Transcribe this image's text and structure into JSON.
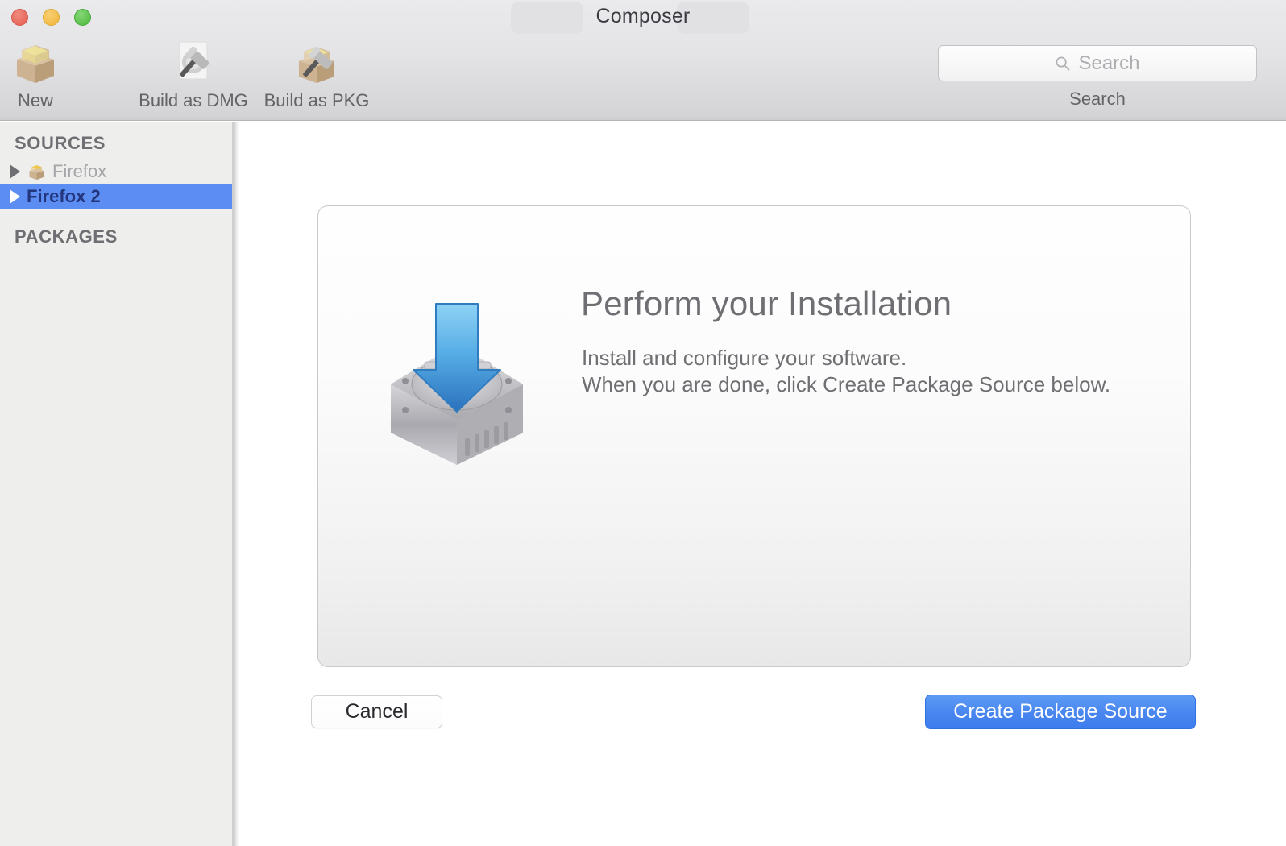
{
  "window": {
    "title": "Composer",
    "traffic_lights": [
      {
        "name": "close",
        "color": "#e8695c"
      },
      {
        "name": "minimize",
        "color": "#f3bc4a"
      },
      {
        "name": "zoom",
        "color": "#5cc14d"
      }
    ]
  },
  "toolbar": {
    "items": [
      {
        "id": "new",
        "label": "New",
        "icon": "package-box-icon"
      },
      {
        "id": "build-dmg",
        "label": "Build as DMG",
        "icon": "hammer-disk-icon"
      },
      {
        "id": "build-pkg",
        "label": "Build as PKG",
        "icon": "hammer-package-icon"
      }
    ],
    "search": {
      "placeholder": "Search",
      "value": "",
      "caption": "Search",
      "icon": "search-icon"
    }
  },
  "sidebar": {
    "sections": [
      {
        "id": "sources",
        "header": "SOURCES",
        "rows": [
          {
            "label": "Firefox",
            "selected": false,
            "has_icon": true,
            "disclosure": "collapsed"
          },
          {
            "label": "Firefox 2",
            "selected": true,
            "has_icon": false,
            "disclosure": "collapsed"
          }
        ]
      },
      {
        "id": "packages",
        "header": "PACKAGES",
        "rows": []
      }
    ],
    "selection_color": "#5b8df3"
  },
  "main": {
    "card": {
      "icon": "hard-drive-download-icon",
      "heading": "Perform your Installation",
      "description_line1": "Install and configure your software.",
      "description_line2": "When you are done, click Create Package Source below."
    },
    "buttons": {
      "cancel": "Cancel",
      "primary": "Create Package Source",
      "primary_color": "#4a87ef"
    }
  }
}
